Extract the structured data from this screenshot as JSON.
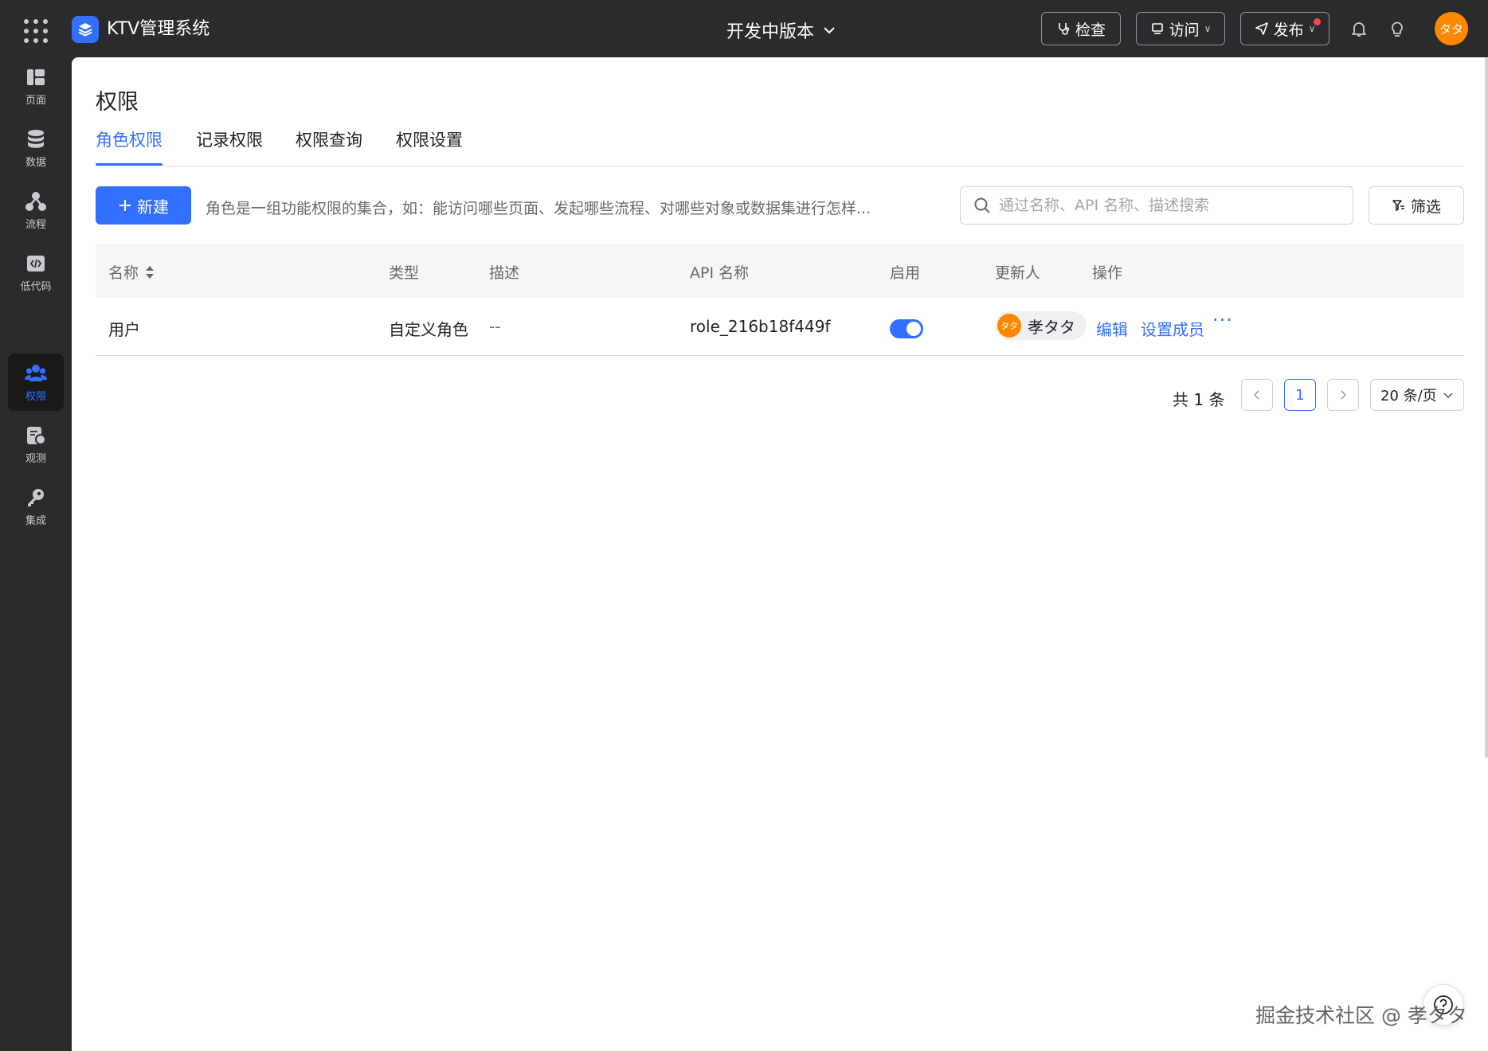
{
  "topbar": {
    "app_title": "KTV管理系统",
    "version_label": "开发中版本",
    "check_label": "检查",
    "visit_label": "访问",
    "publish_label": "发布",
    "avatar_text": "タタ"
  },
  "sidebar": {
    "items": [
      {
        "label": "页面",
        "icon": "page-icon"
      },
      {
        "label": "数据",
        "icon": "database-icon"
      },
      {
        "label": "流程",
        "icon": "flow-icon"
      },
      {
        "label": "低代码",
        "icon": "code-icon"
      },
      {
        "label": "权限",
        "icon": "permission-icon",
        "active": true
      },
      {
        "label": "观测",
        "icon": "monitor-icon"
      },
      {
        "label": "集成",
        "icon": "key-icon"
      }
    ]
  },
  "page": {
    "title": "权限",
    "tabs": [
      {
        "label": "角色权限",
        "active": true
      },
      {
        "label": "记录权限"
      },
      {
        "label": "权限查询"
      },
      {
        "label": "权限设置"
      }
    ]
  },
  "toolbar": {
    "new_label": "新建",
    "description": "角色是一组功能权限的集合，如：能访问哪些页面、发起哪些流程、对哪些对象或数据集进行怎样...",
    "search_placeholder": "通过名称、API 名称、描述搜索",
    "filter_label": "筛选"
  },
  "table": {
    "columns": [
      "名称",
      "类型",
      "描述",
      "API 名称",
      "启用",
      "更新人",
      "操作"
    ],
    "rows": [
      {
        "name": "用户",
        "type": "自定义角色",
        "description": "--",
        "api_name": "role_216b18f449f",
        "enabled": true,
        "updater": "孝タタ",
        "updater_avatar": "タタ",
        "actions": [
          "编辑",
          "设置成员"
        ]
      }
    ]
  },
  "pagination": {
    "total": "共 1 条",
    "current_page": "1",
    "page_size": "20 条/页"
  },
  "watermark": "掘金技术社区 @ 孝タタ",
  "colors": {
    "accent": "#3370ff",
    "topbar_bg": "#2b2b2d",
    "avatar_orange": "#ff8800"
  }
}
